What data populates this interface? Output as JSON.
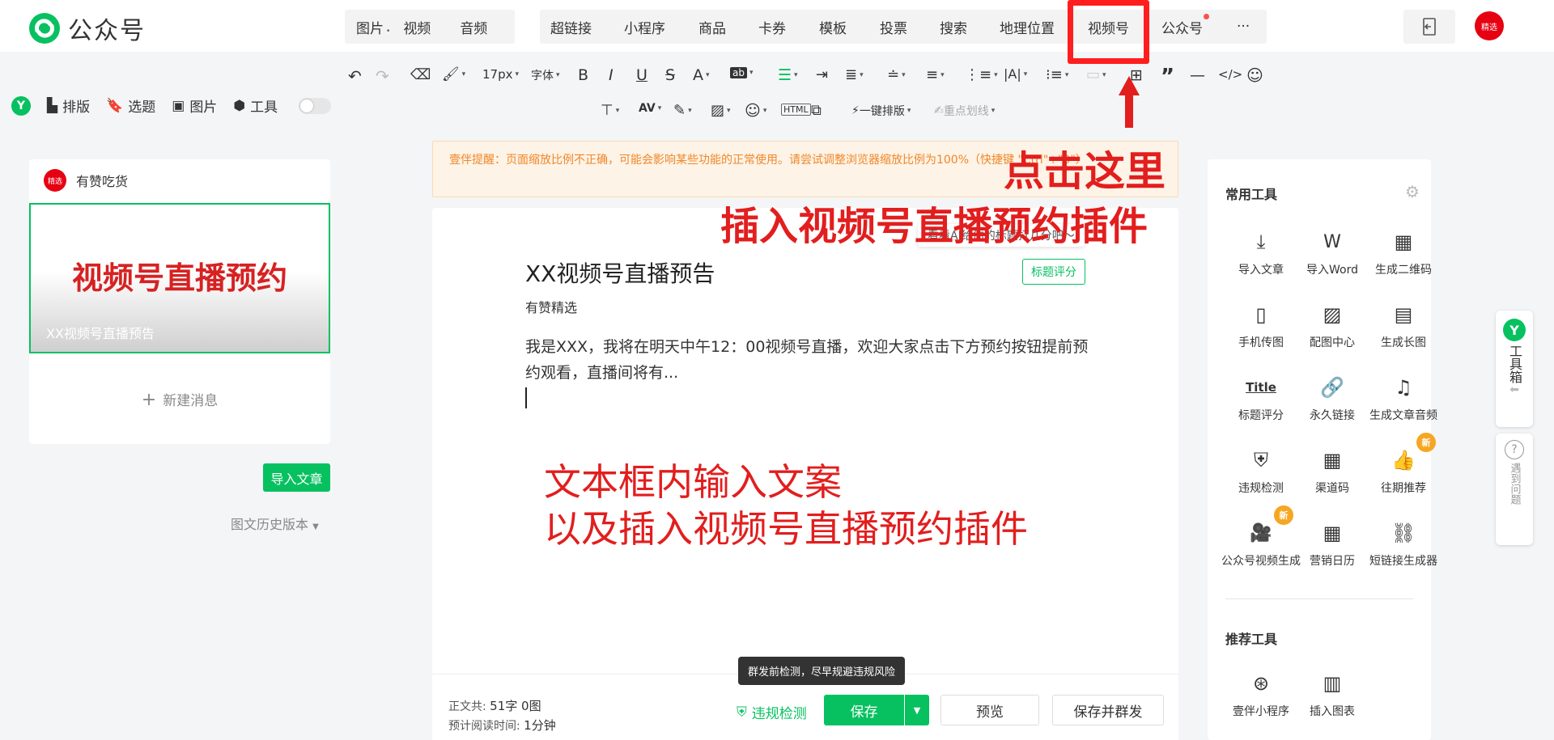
{
  "app": {
    "title": "公众号"
  },
  "nav": {
    "media": [
      {
        "label": "图片",
        "caret": true
      },
      {
        "label": "视频"
      },
      {
        "label": "音频"
      }
    ],
    "insert": [
      {
        "label": "超链接"
      },
      {
        "label": "小程序"
      },
      {
        "label": "商品"
      },
      {
        "label": "卡券"
      },
      {
        "label": "模板"
      },
      {
        "label": "投票"
      },
      {
        "label": "搜索"
      },
      {
        "label": "地理位置"
      },
      {
        "label": "视频号"
      },
      {
        "label": "公众号"
      },
      {
        "label": "···"
      }
    ],
    "avatar_text": "精选"
  },
  "toolbar": {
    "font_size": "17px",
    "font_family": "字体",
    "one_click": "一键排版",
    "highlight": "重点划线"
  },
  "left_tools": {
    "layout": "排版",
    "topic": "选题",
    "image": "图片",
    "tools": "工具"
  },
  "account": {
    "name": "有赞吃货",
    "badge": "精选"
  },
  "article_card": {
    "cover_text": "视频号直播预约",
    "title": "XX视频号直播预告",
    "new_message": "新建消息"
  },
  "sidebar_actions": {
    "import": "导入文章",
    "history": "图文历史版本"
  },
  "warning": "壹伴提醒：页面缩放比例不正确，可能会影响某些功能的正常使用。请尝试调整浏览器缩放比例为100%（快捷键 \"Ctrl\"+\"0\"）",
  "ai_hint": "看看AI给你的标题打几分吧～",
  "title_score": "标题评分",
  "editor": {
    "title": "XX视频号直播预告",
    "author": "有赞精选",
    "body": "我是XXX，我将在明天中午12：00视频号直播，欢迎大家点击下方预约按钮提前预约观看，直播间将有..."
  },
  "annotations": {
    "click_here": "点击这里",
    "insert_plugin": "插入视频号直播预约插件",
    "input_line1": "文本框内输入文案",
    "input_line2": "以及插入视频号直播预约插件"
  },
  "footer": {
    "word_label": "正文共:",
    "word_count": "51字 0图",
    "read_label": "预计阅读时间:",
    "read_time": "1分钟",
    "check": "违规检测",
    "tooltip": "群发前检测，尽早规避违规风险",
    "save": "保存",
    "preview": "预览",
    "save_send": "保存并群发"
  },
  "tools_panel": {
    "common_title": "常用工具",
    "common": [
      "导入文章",
      "导入Word",
      "生成二维码",
      "手机传图",
      "配图中心",
      "生成长图",
      "标题评分",
      "永久链接",
      "生成文章音频",
      "违规检测",
      "渠道码",
      "往期推荐",
      "公众号视频生成",
      "营销日历",
      "短链接生成器"
    ],
    "new_badge": "新",
    "recommend_title": "推荐工具",
    "recommend": [
      "壹伴小程序",
      "插入图表"
    ]
  },
  "toolbox": {
    "label": "工具箱",
    "help": "遇到问题"
  },
  "colors": {
    "brand": "#07c160",
    "annotation": "#e21e1e",
    "highlight_box": "#ff1e1e"
  }
}
